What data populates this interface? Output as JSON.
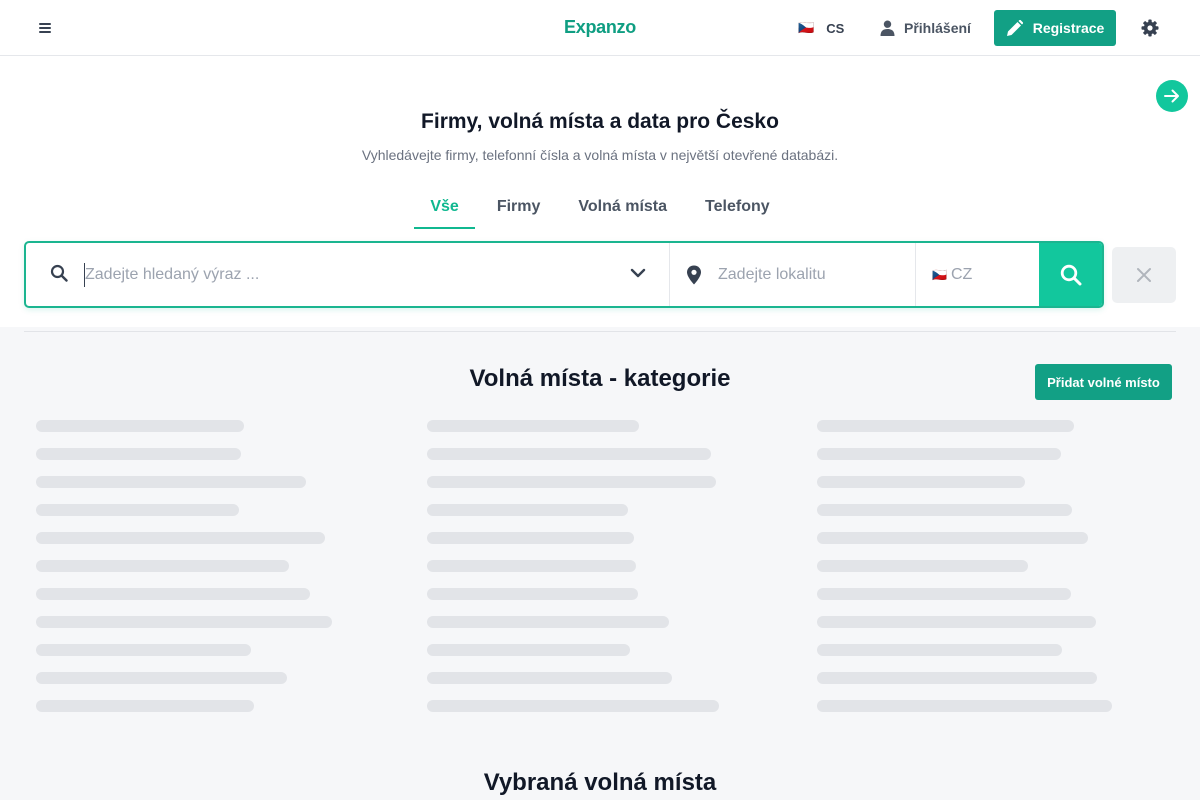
{
  "header": {
    "menu_icon": "hamburger-icon",
    "logo": "Expanzo",
    "language_code": "CS",
    "language_flag": "🇨🇿",
    "login_label": "Přihlášení",
    "register_label": "Registrace",
    "settings_icon": "gear-icon"
  },
  "hero": {
    "title": "Firmy, volná místa a data pro Česko",
    "subtitle": "Vyhledávejte firmy, telefonní čísla a volná místa v největší otevřené databázi.",
    "tabs": [
      {
        "label": "Vše",
        "active": true
      },
      {
        "label": "Firmy",
        "active": false
      },
      {
        "label": "Volná místa",
        "active": false
      },
      {
        "label": "Telefony",
        "active": false
      }
    ]
  },
  "search": {
    "query_placeholder": "Zadejte hledaný výraz ...",
    "query_value": "",
    "location_placeholder": "Zadejte lokalitu",
    "country_flag": "🇨🇿",
    "country_code": "CZ"
  },
  "categories": {
    "title": "Volná místa - kategorie",
    "add_button": "Přidat volné místo",
    "loading": true
  },
  "featured": {
    "title": "Vybraná volná místa"
  },
  "colors": {
    "brand": "#12a085",
    "accent": "#12c79d",
    "skeleton": "#e2e4e8"
  }
}
